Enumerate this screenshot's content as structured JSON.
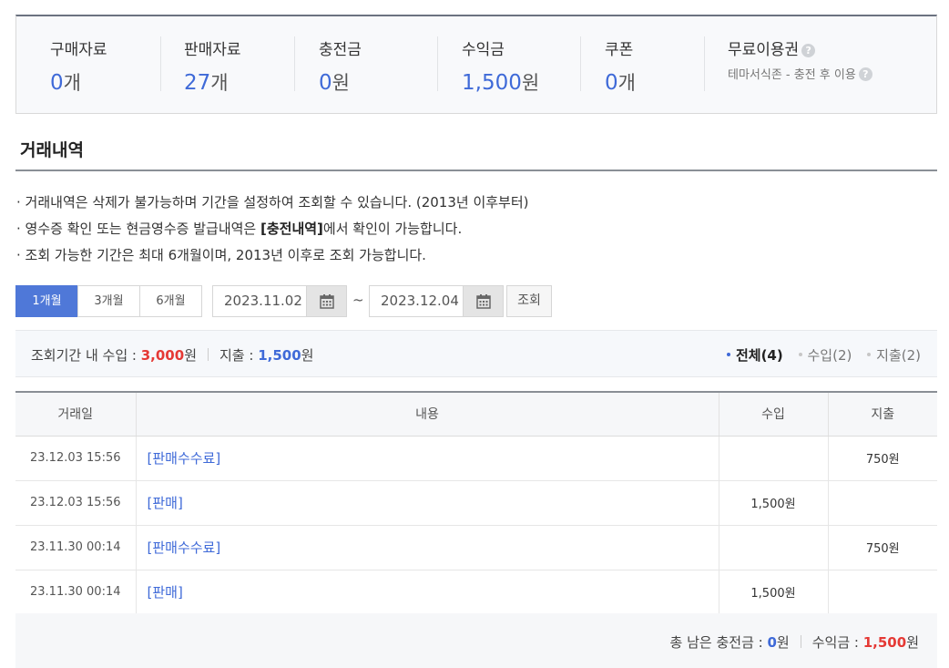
{
  "summary": {
    "purchase": {
      "label": "구매자료",
      "value": "0",
      "unit": "개"
    },
    "sales": {
      "label": "판매자료",
      "value": "27",
      "unit": "개"
    },
    "charge": {
      "label": "충전금",
      "value": "0",
      "unit": "원"
    },
    "revenue": {
      "label": "수익금",
      "value": "1,500",
      "unit": "원"
    },
    "coupon": {
      "label": "쿠폰",
      "value": "0",
      "unit": "개"
    },
    "free_pass": {
      "label": "무료이용권",
      "sub": "테마서식존 - 충전 후 이용"
    }
  },
  "section": {
    "title": "거래내역",
    "notes": [
      "거래내역은 삭제가 불가능하며 기간을 설정하여 조회할 수 있습니다. (2013년 이후부터)",
      "조회 가능한 기간은 최대 6개월이며, 2013년 이후로 조회 가능합니다."
    ],
    "note2_prefix": "영수증 확인 또는 현금영수증 발급내역은 ",
    "note2_bold": "[충전내역]",
    "note2_suffix": "에서 확인이 가능합니다."
  },
  "period": {
    "buttons": [
      "1개월",
      "3개월",
      "6개월"
    ],
    "active_index": 0,
    "start_date": "2023.11.02",
    "tilde": "~",
    "end_date": "2023.12.04",
    "query_label": "조회"
  },
  "sumbar": {
    "income_label": "조회기간 내 수입 : ",
    "income_value": "3,000",
    "income_unit": "원",
    "expense_label": "지출 : ",
    "expense_value": "1,500",
    "expense_unit": "원",
    "filters": [
      {
        "label": "전체",
        "count": "(4)",
        "active": true
      },
      {
        "label": "수입",
        "count": "(2)",
        "active": false
      },
      {
        "label": "지출",
        "count": "(2)",
        "active": false
      }
    ]
  },
  "table": {
    "headers": [
      "거래일",
      "내용",
      "수입",
      "지출"
    ],
    "rows": [
      {
        "date": "23.12.03 15:56",
        "content": "[판매수수료]",
        "income": "",
        "expense": "750원"
      },
      {
        "date": "23.12.03 15:56",
        "content": "[판매]",
        "income": "1,500원",
        "expense": ""
      },
      {
        "date": "23.11.30 00:14",
        "content": "[판매수수료]",
        "income": "",
        "expense": "750원"
      },
      {
        "date": "23.11.30 00:14",
        "content": "[판매]",
        "income": "1,500원",
        "expense": ""
      }
    ]
  },
  "footer": {
    "charge_label": "총 남은 충전금 : ",
    "charge_value": "0",
    "charge_unit": "원",
    "revenue_label": "수익금 : ",
    "revenue_value": "1,500",
    "revenue_unit": "원"
  },
  "colors": {
    "accent": "#3f6ad8",
    "danger": "#e53935",
    "active_button": "#4f78d8"
  },
  "icons": {
    "help": "question-circle-icon",
    "calendar": "calendar-icon"
  }
}
